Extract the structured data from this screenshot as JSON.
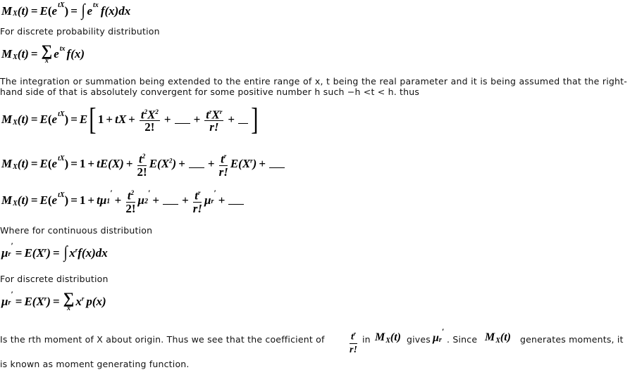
{
  "formulas": {
    "mgf_continuous": "M_X(t) = E(e^{tX}) = ∫ e^{tx} f(x) dx",
    "mgf_discrete": "M_X(t) = Σ_x e^{tx} f(x)",
    "expansion_1": "M_X(t) = E(e^{tX}) = E[1 + tX + t^2X^2/2! + ___ + t^rX^r/r! + ___]",
    "expansion_2": "M_X(t) = E(e^{tX}) = 1 + tE(X) + t^2/2! E(X^2) + ___ + t^r/r! E(X^r) + ___",
    "expansion_3": "M_X(t) = E(e^{tX}) = 1 + tμ1' + t^2/2! μ2' + ___ + t^r/r! μr' + ___",
    "moment_continuous": "μr' = E(X^r) = ∫ x^r f(x) dx",
    "moment_discrete": "μr' = E(X^r) = Σ_x x^r p(x)"
  },
  "text": {
    "discrete_prob_label": "For discrete probability distribution",
    "paragraph_1": "The integration or summation being extended to the entire range of x, t being the real parameter and it is being assumed that the right-hand  side of that is absolutely convergent for some positive number h such −h <t < h. thus",
    "continuous_label": "Where for continuous distribution",
    "discrete_label": "For discrete distribution",
    "final_part1": "Is the rth moment of X about origin. Thus we see that the coefficient of",
    "final_in": "in",
    "final_gives": "gives",
    "final_since": ". Since",
    "final_part2": "generates moments, it",
    "final_line2": "is known as moment generating function."
  },
  "symbols": {
    "M": "M",
    "X": "X",
    "t": "(t)",
    "E": "E",
    "e": "e",
    "tX": "tX",
    "tx": "tx",
    "f_x_dx": "f(x)dx",
    "f_x": "f(x)",
    "p_x": "p(x)",
    "x": "x",
    "r": "r",
    "two": "2",
    "one": "1",
    "two_fact": "2!",
    "r_fact": "r!",
    "mu": "μ",
    "prime": "′",
    "eq": "=",
    "plus": "+",
    "integral": "∫",
    "sigma": "∑",
    "lbracket": "[",
    "rbracket": "]",
    "lparen": "(",
    "rparen": ")",
    "EX": "E(X)",
    "tE": "tE(X)"
  }
}
